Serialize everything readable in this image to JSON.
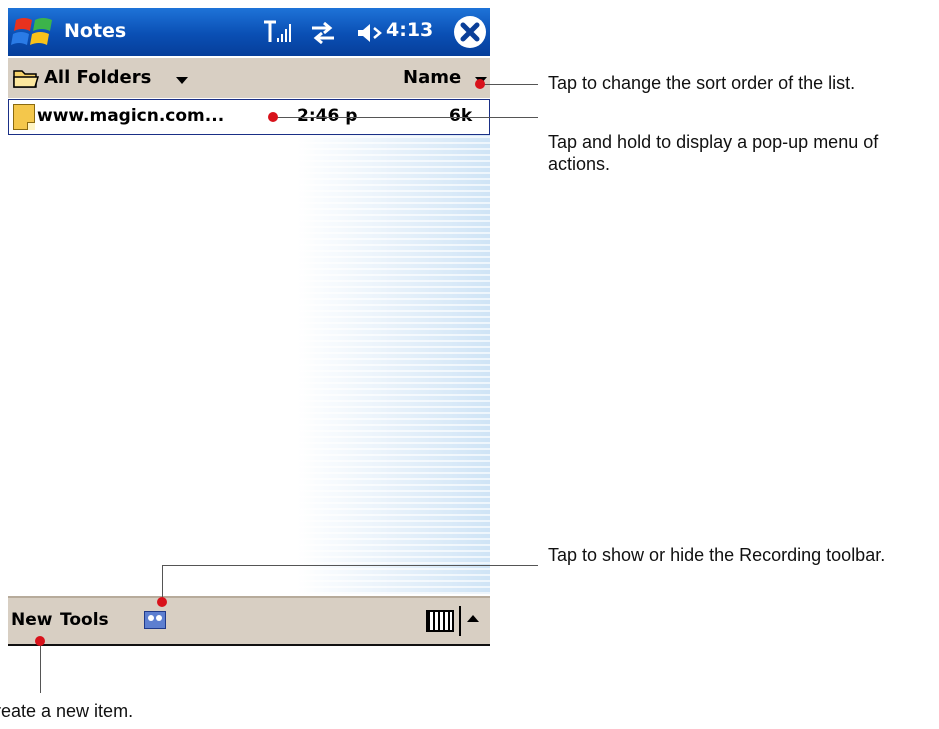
{
  "titlebar": {
    "app_title": "Notes",
    "time": "4:13"
  },
  "folderbar": {
    "folder_label": "All Folders",
    "sort_label": "Name"
  },
  "list": {
    "items": [
      {
        "name": "www.magicn.com...",
        "time": "2:46 p",
        "size": "6k"
      }
    ]
  },
  "toolbar": {
    "new_label": "New",
    "tools_label": "Tools"
  },
  "callouts": {
    "sort": "Tap to change the sort order of the list.",
    "hold": "Tap and hold to display a pop-up menu of actions.",
    "recording": "Tap to show or hide the Recording toolbar.",
    "new": "Create a new item."
  },
  "icons": [
    "start-menu-icon",
    "signal-icon",
    "sync-icon",
    "speaker-icon",
    "close-icon",
    "folder-icon",
    "note-icon",
    "recording-icon",
    "keyboard-icon",
    "sip-arrow-icon"
  ],
  "colors": {
    "titlebar": "#0a4fb4",
    "bars": "#d8cfc3",
    "callout_dot": "#d8121b"
  }
}
